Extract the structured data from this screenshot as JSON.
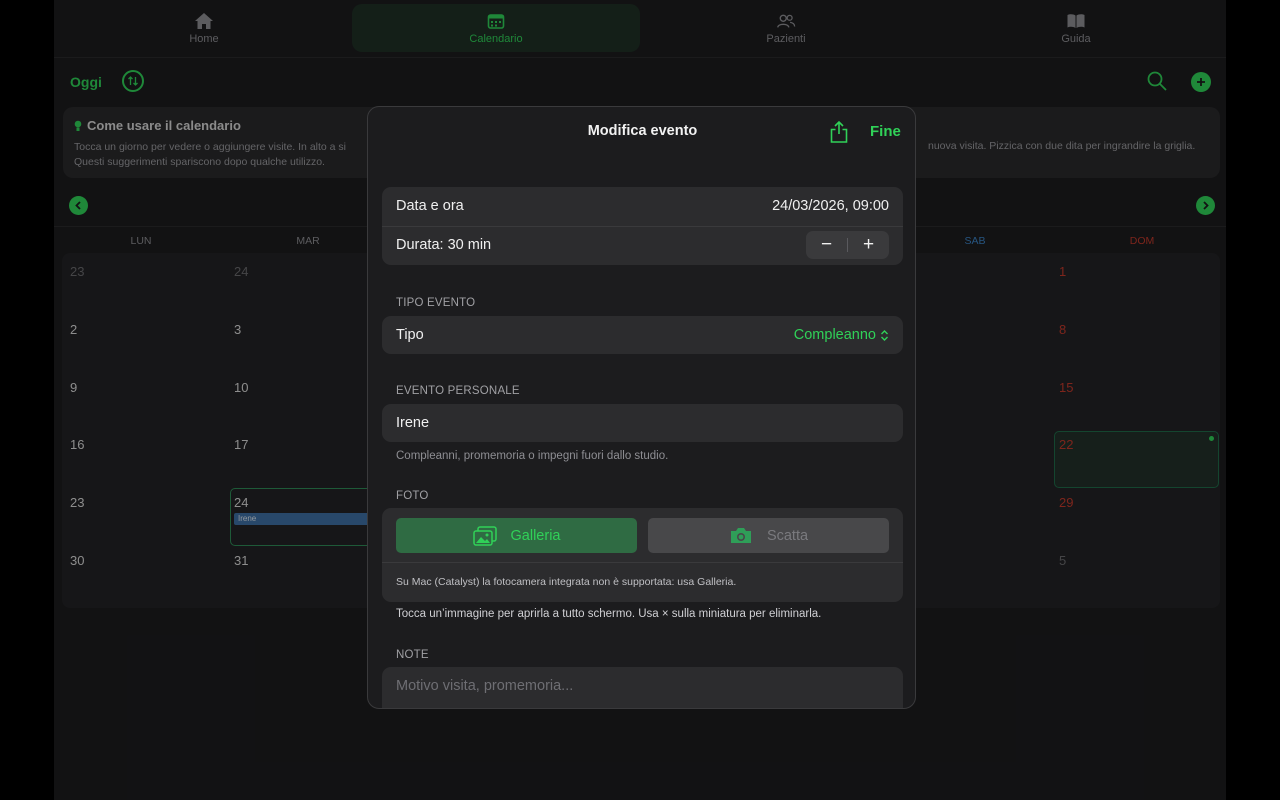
{
  "tabs": [
    {
      "label": "Home",
      "icon": "house-icon"
    },
    {
      "label": "Calendario",
      "icon": "calendar-icon",
      "active": true
    },
    {
      "label": "Pazienti",
      "icon": "people-icon"
    },
    {
      "label": "Guida",
      "icon": "book-icon"
    }
  ],
  "toolbar": {
    "today_label": "Oggi"
  },
  "tips": {
    "title": "Come usare il calendario",
    "line1": "Tocca un giorno per vedere o aggiungere visite. In alto a si",
    "line2": "Questi suggerimenti spariscono dopo qualche utilizzo.",
    "right": "nuova visita. Pizzica con due dita per ingrandire la griglia."
  },
  "weekdays": {
    "mon": "LUN",
    "tue": "MAR",
    "sat": "SAB",
    "sun": "DOM"
  },
  "calendar": {
    "rows": [
      {
        "mon": "23",
        "tue": "24",
        "sun": "1"
      },
      {
        "mon": "2",
        "tue": "3",
        "sun": "8"
      },
      {
        "mon": "9",
        "tue": "10",
        "sun": "15"
      },
      {
        "mon": "16",
        "tue": "17",
        "sun": "22"
      },
      {
        "mon": "23",
        "tue": "24",
        "sun": "29"
      },
      {
        "mon": "30",
        "tue": "31",
        "sun": "5"
      }
    ],
    "event_chip": "Irene"
  },
  "modal": {
    "title": "Modifica evento",
    "done_label": "Fine",
    "date_label": "Data e ora",
    "date_value": "24/03/2026, 09:00",
    "duration_label": "Durata: 30 min",
    "stepper_minus": "−",
    "stepper_plus": "+",
    "type_section": "TIPO EVENTO",
    "type_label": "Tipo",
    "type_value": "Compleanno",
    "personal_section": "EVENTO PERSONALE",
    "personal_value": "Irene",
    "personal_hint": "Compleanni, promemoria o impegni fuori dallo studio.",
    "photo_section": "FOTO",
    "gallery_label": "Galleria",
    "camera_label": "Scatta",
    "photo_note": "Su Mac (Catalyst) la fotocamera integrata non è supportata: usa Galleria.",
    "photo_hint": "Tocca un’immagine per aprirla a tutto schermo. Usa × sulla miniatura per eliminarla.",
    "notes_section": "NOTE",
    "notes_placeholder": "Motivo visita, promemoria..."
  },
  "colors": {
    "accent": "#30d158",
    "sunday": "#c0392b",
    "saturday": "#3b82c4",
    "chip": "#3e6fa3"
  }
}
